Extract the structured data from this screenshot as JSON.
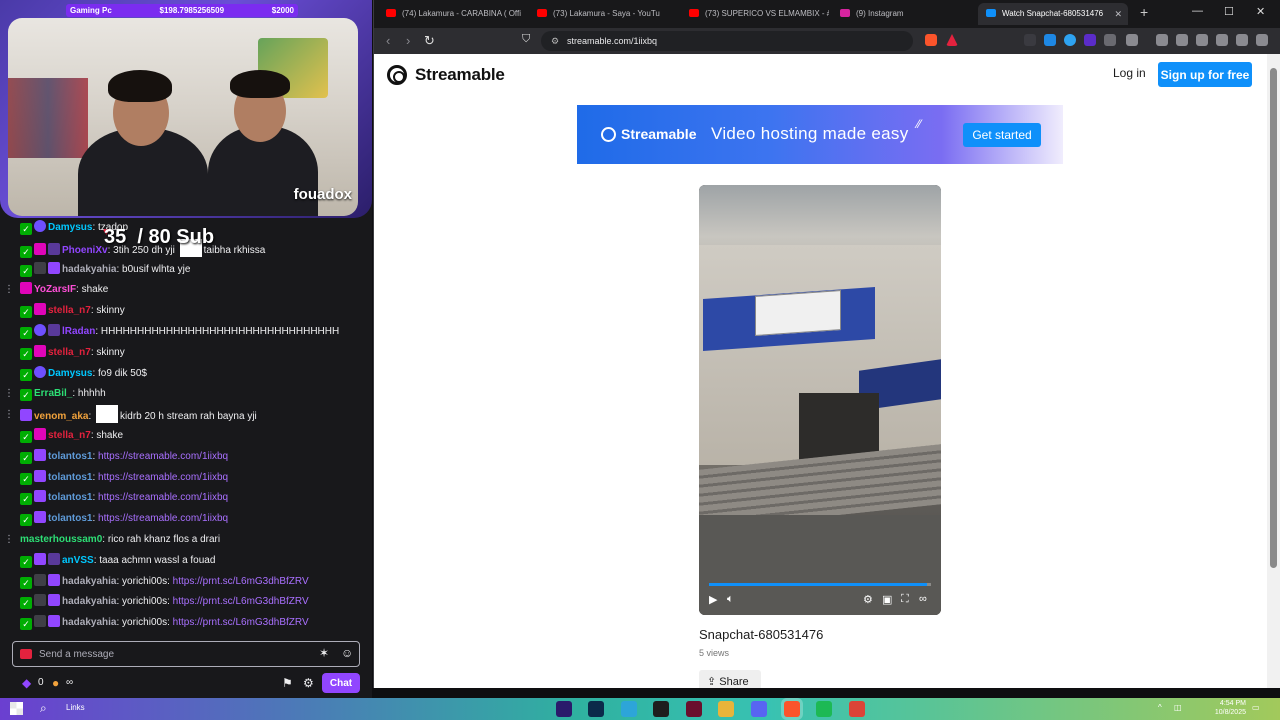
{
  "stream": {
    "overlay_title": "Gaming Pc",
    "overlay_value": "$198.7985256509",
    "overlay_goal": "$2000",
    "channel_name": "fouadox",
    "sub_goal": "35  / 80 Sub"
  },
  "chat": {
    "messages": [
      {
        "user": "Damysus",
        "user_color": "#00c8ff",
        "badges": [
          "mod",
          "verified"
        ],
        "text": "tzadop",
        "more": false
      },
      {
        "user": "PhoeniXv",
        "user_color": "#9146ff",
        "badges": [
          "mod",
          "vip",
          "turbo"
        ],
        "text": "3tih 250 dh yji",
        "after_thumb": "taibha rkhissa",
        "thumb": true,
        "more": false
      },
      {
        "user": "hadakyahia",
        "user_color": "#adadb8",
        "badges": [
          "mod",
          "sub",
          "gift"
        ],
        "text": "b0usif wlhta yje",
        "more": false
      },
      {
        "user": "YoZarsIF",
        "user_color": "#ff4fd8",
        "badges": [
          "vip"
        ],
        "text": "shake",
        "more": true
      },
      {
        "user": "stella_n7",
        "user_color": "#e3223e",
        "badges": [
          "mod",
          "vip"
        ],
        "text": "skinny",
        "more": false
      },
      {
        "user": "lRadan",
        "user_color": "#9146ff",
        "badges": [
          "mod",
          "verified",
          "turbo"
        ],
        "text": "HHHHHHHHHHHHHHHHHHHHHHHHHHHHHHHHH",
        "more": false
      },
      {
        "user": "stella_n7",
        "user_color": "#e3223e",
        "badges": [
          "mod",
          "vip"
        ],
        "text": "skinny",
        "more": false
      },
      {
        "user": "Damysus",
        "user_color": "#00c8ff",
        "badges": [
          "mod",
          "verified"
        ],
        "text": "fo9 dik 50$",
        "more": false
      },
      {
        "user": "ErraBil_",
        "user_color": "#2ddf75",
        "badges": [
          "mod"
        ],
        "text": "hhhhh",
        "more": true
      },
      {
        "user": "venom_aka",
        "user_color": "#f1a23c",
        "badges": [
          "gift"
        ],
        "text": "",
        "after_thumb": "kidrb 20 h stream rah bayna yji",
        "thumb": true,
        "more": true
      },
      {
        "user": "stella_n7",
        "user_color": "#e3223e",
        "badges": [
          "mod",
          "vip"
        ],
        "text": "shake",
        "more": false
      },
      {
        "user": "tolantos1",
        "user_color": "#5e9ad8",
        "badges": [
          "mod",
          "gift"
        ],
        "text": "",
        "link": "https://streamable.com/1iixbq",
        "more": false
      },
      {
        "user": "tolantos1",
        "user_color": "#5e9ad8",
        "badges": [
          "mod",
          "gift"
        ],
        "text": "",
        "link": "https://streamable.com/1iixbq",
        "more": false
      },
      {
        "user": "tolantos1",
        "user_color": "#5e9ad8",
        "badges": [
          "mod",
          "gift"
        ],
        "text": "",
        "link": "https://streamable.com/1iixbq",
        "more": false
      },
      {
        "user": "tolantos1",
        "user_color": "#5e9ad8",
        "badges": [
          "mod",
          "gift"
        ],
        "text": "",
        "link": "https://streamable.com/1iixbq",
        "more": false
      },
      {
        "user": "masterhoussam0",
        "user_color": "#2ddf75",
        "badges": [],
        "text": "rico rah khanz flos a drari",
        "more": true
      },
      {
        "user": "anVSS",
        "user_color": "#00c8ff",
        "badges": [
          "mod",
          "gift",
          "turbo"
        ],
        "text": "taaa achmn wassl a fouad",
        "more": false
      },
      {
        "user": "hadakyahia",
        "user_color": "#adadb8",
        "badges": [
          "mod",
          "sub",
          "gift"
        ],
        "text": "yorichi00s:",
        "link": "https://prnt.sc/L6mG3dhBfZRV",
        "more": false
      },
      {
        "user": "hadakyahia",
        "user_color": "#adadb8",
        "badges": [
          "mod",
          "sub",
          "gift"
        ],
        "text": "yorichi00s:",
        "link": "https://prnt.sc/L6mG3dhBfZRV",
        "more": false
      },
      {
        "user": "hadakyahia",
        "user_color": "#adadb8",
        "badges": [
          "mod",
          "sub",
          "gift"
        ],
        "text": "yorichi00s:",
        "link": "https://prnt.sc/L6mG3dhBfZRV",
        "more": false
      }
    ],
    "input_placeholder": "Send a message",
    "points": "0",
    "infinity": "∞",
    "chat_button": "Chat"
  },
  "browser": {
    "tabs": [
      {
        "title": "(74) Lakamura - CARABINA ( Offi",
        "favicon_color": "#ff0000",
        "active": false
      },
      {
        "title": "(73) Lakamura - Saya - YouTu",
        "favicon_color": "#ff0000",
        "active": false
      },
      {
        "title": "(73) SUPERICO VS ELMAMBIX - #",
        "favicon_color": "#ff0000",
        "active": false
      },
      {
        "title": "(9) Instagram",
        "favicon_color": "#d6249f",
        "active": false
      },
      {
        "title": "Watch Snapchat-680531476",
        "favicon_color": "#0f90fa",
        "active": true
      }
    ],
    "url": "streamable.com/1iixbq"
  },
  "streamable": {
    "brand": "Streamable",
    "login": "Log in",
    "signup": "Sign up for free",
    "banner_brand": "Streamable",
    "banner_slogan": "Video hosting made easy",
    "banner_cta": "Get started",
    "video_title": "Snapchat-680531476",
    "views": "5 views",
    "share": "Share",
    "progress": 0.98
  },
  "taskbar": {
    "search_label": "Links",
    "time": "4:54 PM",
    "date": "10/8/2025",
    "apps": [
      {
        "name": "premiere-app",
        "color": "#2a1a6b"
      },
      {
        "name": "photoshop-app",
        "color": "#0b2a4a"
      },
      {
        "name": "files-app",
        "color": "#2da5d9"
      },
      {
        "name": "obs-app",
        "color": "#1e1e1e"
      },
      {
        "name": "affinity-app",
        "color": "#6a0f2d"
      },
      {
        "name": "explorer-app",
        "color": "#e8b43a"
      },
      {
        "name": "discord-app",
        "color": "#5865f2"
      },
      {
        "name": "brave-app",
        "color": "#fb542b"
      },
      {
        "name": "spotify-app",
        "color": "#1db954"
      },
      {
        "name": "chrome-app",
        "color": "#db4437"
      }
    ]
  }
}
